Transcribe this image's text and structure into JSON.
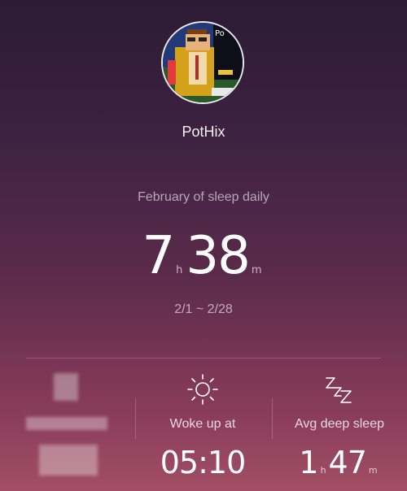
{
  "profile": {
    "username": "PotHix",
    "avatar_icon": "pixel-art-avatar",
    "avatar_text": "Po"
  },
  "summary": {
    "subtitle": "February of sleep daily",
    "hours": "7",
    "hours_unit": "h",
    "minutes": "38",
    "minutes_unit": "m",
    "date_range": "2/1 ~ 2/28"
  },
  "stats": [
    {
      "icon": "moon-icon",
      "label": "",
      "value": "",
      "redacted": true
    },
    {
      "icon": "sun-icon",
      "label": "Woke up at",
      "value": "05:10"
    },
    {
      "icon": "zzz-icon",
      "label": "Avg deep sleep",
      "hours": "1",
      "hours_unit": "h",
      "minutes": "47",
      "minutes_unit": "m"
    }
  ],
  "colors": {
    "bg_top": "#2b1b33",
    "bg_bottom": "#a24f66",
    "text": "#ffffff",
    "muted": "#b8a6b8"
  }
}
